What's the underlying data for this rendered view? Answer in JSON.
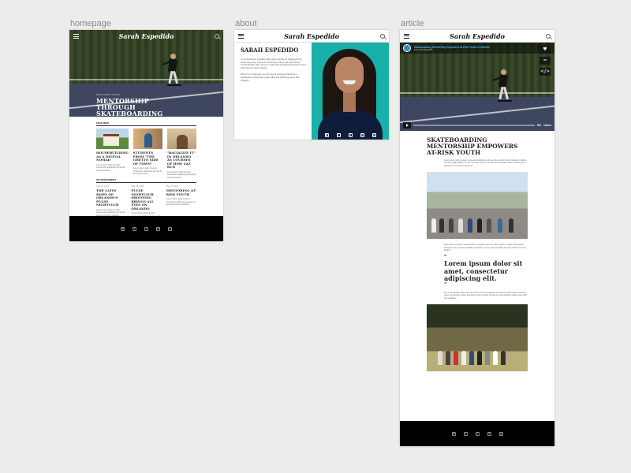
{
  "boards": {
    "homepage": "homepage",
    "about": "about",
    "article": "article"
  },
  "site": {
    "brand": "Sarah Espedido"
  },
  "homepage": {
    "hero_kicker": "FEATURED STORY",
    "hero_title": "MENTORSHIP THROUGH SKATEBOARDING",
    "features_label": "FEATURES",
    "features": [
      {
        "title": "HOUSEBUILDING AS A DIGITAL NOMAD",
        "meta": "",
        "text": "Lorem ipsum dolor sit amet, consectetur adipiscing elit sed do eiusmod tempor."
      },
      {
        "title": "STUDENTS FROM \"THE GHETTO SIDE OF TOWN\"",
        "meta": "",
        "text": "Lorem ipsum dolor sit amet, consectetur adipiscing elit sed do eiusmod tempor."
      },
      {
        "title": "\"RACIALIZE IT\" IN ORLANDO AS COURSES OF HOW ZAZ RUN",
        "meta": "",
        "text": "Lorem ipsum dolor sit amet, consectetur adipiscing elit sed do eiusmod tempor."
      }
    ],
    "assignment_label": "ON ASSIGNMENT",
    "assignments": [
      {
        "date": "June 24, 2015",
        "title": "THE LATIN RISES OF ORLANDO'S PULSE NIGHTCLUB",
        "text": "Lorem ipsum dolor sit amet, consectetur adipiscing elit sed do eiusmod tempor incididunt."
      },
      {
        "date": "June 18, 2015",
        "title": "PULSE NIGHTCLUB SHOOTING BRINGS ALL EYES ON ORLANDO",
        "text": "Lorem ipsum dolor sit amet, consectetur adipiscing elit sed do eiusmod tempor incididunt."
      },
      {
        "date": "May 12, 2015",
        "title": "MENTORING AT-RISK YOUTH",
        "text": "Lorem ipsum dolor sit amet, consectetur adipiscing elit sed do eiusmod tempor incididunt."
      }
    ]
  },
  "about": {
    "name": "SARAH ESPEDIDO",
    "para1": "I'm a Florida-born journalist with a deep curiosity for people and the stories they carry. I report on community, culture and youth across Central Florida, with a focus on multimedia storytelling that gives voice to those who are often unheard.",
    "para2": "When I'm not reporting you can find me exploring Orlando on a skateboard, hunting down great coffee and collecting stories from strangers."
  },
  "article": {
    "video_title": "Skateboarding Mentorship Empowers At-Risk Youth of Orlando",
    "video_from": "from Sarah Espedido",
    "vimeo": "vimeo",
    "hd": "HD",
    "title": "SKATEBOARDING MENTORSHIP EMPOWERS AT-RISK YOUTH",
    "para1": "Lorem ipsum dolor sit amet, consectetur adipiscing elit, sed do eiusmod tempor incididunt ut labore et dolore magna aliqua. Ut enim ad minim veniam, quis nostrud exercitation ullamco laboris nisi ut aliquip ex ea commodo consequat.",
    "para2": "Duis aute irure dolor in reprehenderit in voluptate velit esse cillum dolore eu fugiat nulla pariatur. Excepteur sint occaecat cupidatat non proident, sunt in culpa qui officia deserunt mollit anim id est laborum.",
    "quote_open": "“",
    "quote": "Lorem ipsum dolor sit amet, consectetur adipiscing elit.",
    "quote_close": "”",
    "para3": "Sed ut perspiciatis unde omnis iste natus error sit voluptatem accusantium doloremque laudantium, totam rem aperiam, eaque ipsa quae ab illo inventore veritatis et quasi architecto beatae vitae dicta sunt explicabo."
  },
  "social": [
    "instagram-icon",
    "twitter-icon",
    "vimeo-icon",
    "linkedin-icon",
    "google-plus-icon"
  ],
  "social_glyphs": [
    "◘",
    "t",
    "v",
    "in",
    "g+"
  ],
  "video_buttons": [
    "♥",
    "≈",
    "</>"
  ]
}
